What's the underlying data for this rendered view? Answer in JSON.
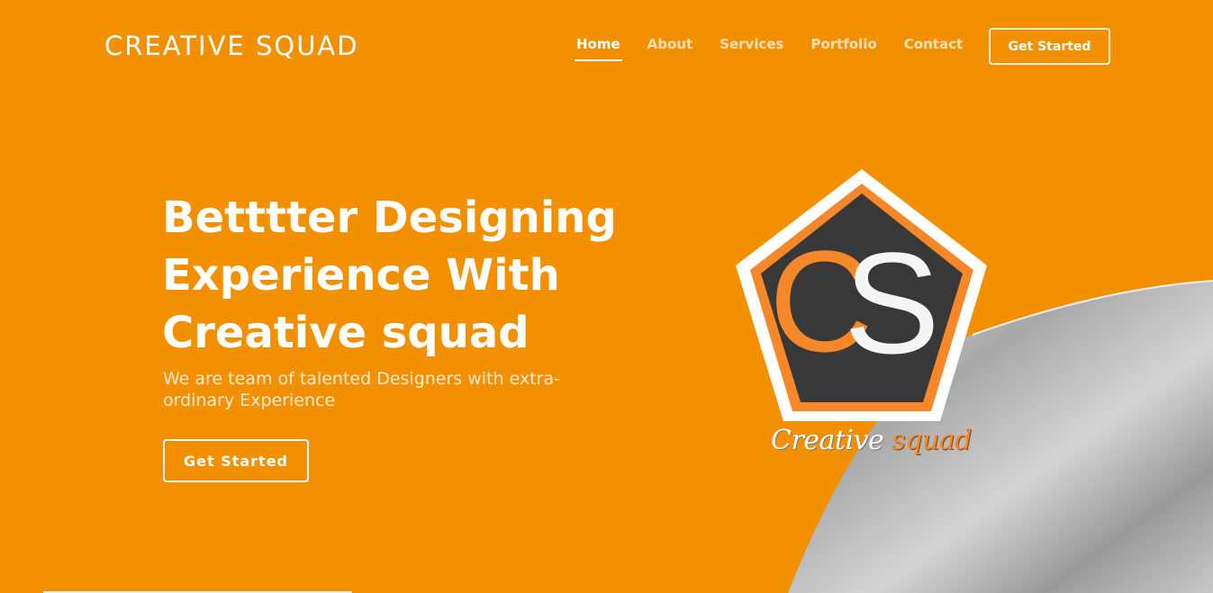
{
  "nav": {
    "brand": "CREATIVE SQUAD",
    "links": [
      {
        "label": "Home",
        "active": true
      },
      {
        "label": "About"
      },
      {
        "label": "Services"
      },
      {
        "label": "Portfolio"
      },
      {
        "label": "Contact"
      }
    ],
    "cta_label": "Get Started"
  },
  "hero": {
    "title": "Betttter Designing Experience With Creative squad",
    "subtitle": "We are team of talented Designers with extra-ordinary Experience",
    "cta_label": "Get Started"
  },
  "logo": {
    "monogram_c": "C",
    "monogram_s": "S",
    "wordmark_1": "Creative",
    "wordmark_2": "squad"
  },
  "colors": {
    "background": "#f39000",
    "logo_dark": "#383838",
    "logo_orange": "#f7882a",
    "white": "#ffffff"
  }
}
